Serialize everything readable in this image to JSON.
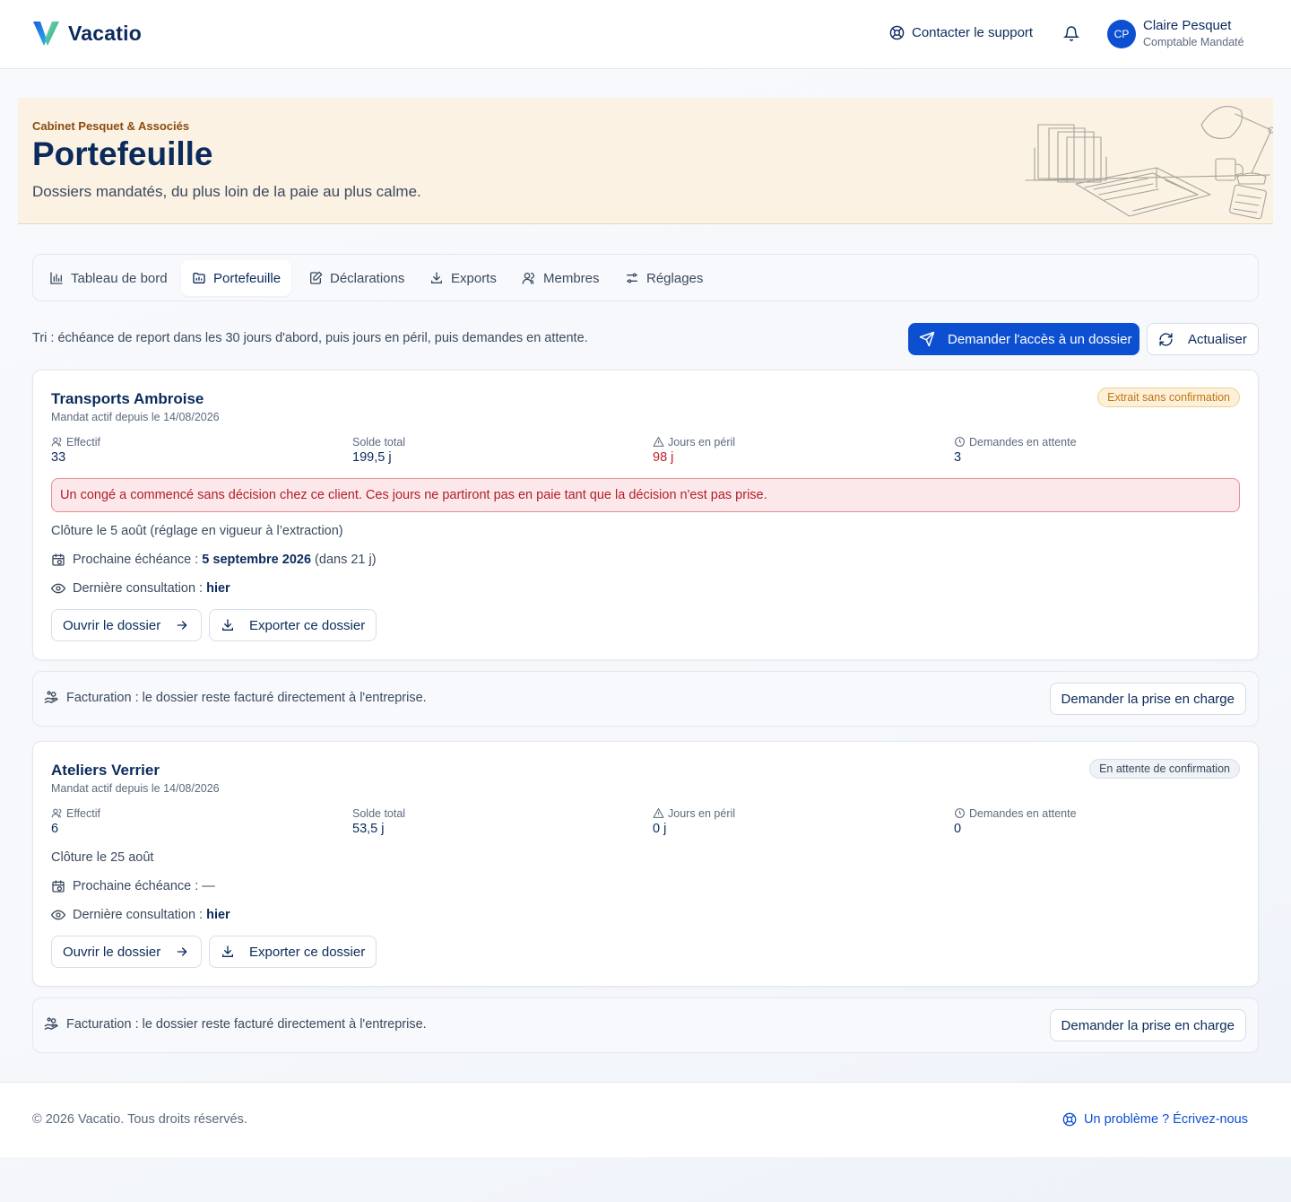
{
  "app": {
    "name": "Vacatio",
    "brand_color": "#0c4fd1"
  },
  "header": {
    "support_label": "Contacter le support",
    "user": {
      "initials": "CP",
      "name": "Claire Pesquet",
      "role": "Comptable Mandaté"
    }
  },
  "hero": {
    "kicker": "Cabinet Pesquet & Associés",
    "title": "Portefeuille",
    "subtitle": "Dossiers mandatés, du plus loin de la paie au plus calme."
  },
  "tabs": [
    {
      "label": "Tableau de bord",
      "icon": "bar-chart-icon"
    },
    {
      "label": "Portefeuille",
      "icon": "folder-icon",
      "active": true
    },
    {
      "label": "Déclarations",
      "icon": "edit-document-icon"
    },
    {
      "label": "Exports",
      "icon": "download-icon"
    },
    {
      "label": "Membres",
      "icon": "users-icon"
    },
    {
      "label": "Réglages",
      "icon": "sliders-icon"
    }
  ],
  "toolbar": {
    "sort_text": "Tri : échéance de report dans les 30 jours d'abord, puis jours en péril, puis demandes en attente.",
    "request_access_label": "Demander l'accès à un dossier",
    "refresh_label": "Actualiser"
  },
  "labels": {
    "effectif": "Effectif",
    "solde_total": "Solde total",
    "jours_peril": "Jours en péril",
    "demandes_attente": "Demandes en attente",
    "next_deadline": "Prochaine échéance :",
    "last_consultation": "Dernière consultation :",
    "open_folder": "Ouvrir le dossier",
    "export_folder": "Exporter ce dossier",
    "billing_text": "Facturation : le dossier reste facturé directement à l'entreprise.",
    "billing_button": "Demander la prise en charge"
  },
  "clients": [
    {
      "name": "Transports Ambroise",
      "mandate": "Mandat actif depuis le 14/08/2026",
      "badge": "Extrait sans confirmation",
      "effectif": "33",
      "solde": "199,5 j",
      "peril": "98 j",
      "demandes": "3",
      "alert": "Un congé a commencé sans décision chez ce client. Ces jours ne partiront pas en paie tant que la décision n'est pas prise.",
      "cloture": "Clôture le 5 août (réglage en vigueur à l’extraction)",
      "next_deadline_date": "5 septembre 2026",
      "next_deadline_delay": "(dans 21 j)",
      "last_consultation": "hier"
    },
    {
      "name": "Ateliers Verrier",
      "mandate": "Mandat actif depuis le 14/08/2026",
      "badge": "En attente de confirmation",
      "effectif": "6",
      "solde": "53,5 j",
      "peril": "0 j",
      "demandes": "0",
      "cloture": "Clôture le 25 août",
      "next_deadline_date": "—",
      "last_consultation": "hier"
    }
  ],
  "footer": {
    "copyright": "© 2026 Vacatio. Tous droits réservés.",
    "help_link": "Un problème ? Écrivez-nous"
  },
  "colors": {
    "danger": "#c0222b",
    "warning": "#c0750d",
    "hero_bg": "#fbf2e3",
    "navy": "#0b2b5c"
  }
}
